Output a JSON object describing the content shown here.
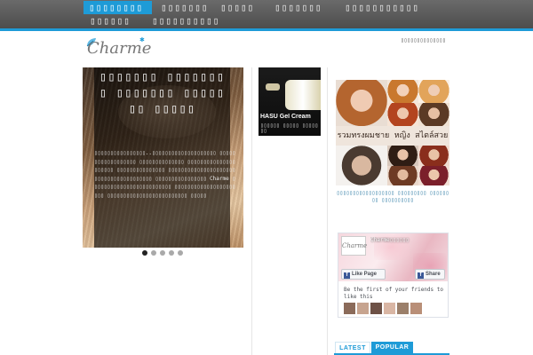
{
  "nav": {
    "row1": [
      "▯▯▯▯▯▯▯▯",
      "▯▯▯▯▯▯▯",
      "▯▯▯▯▯",
      "▯▯▯▯▯▯▯",
      "▯▯▯▯▯▯▯▯▯▯▯"
    ],
    "row2": [
      "▯▯▯▯▯▯",
      "▯▯▯▯▯▯▯▯▯▯"
    ],
    "active_index": 0
  },
  "header": {
    "logo_text": "Charme",
    "right_text": "▯▯▯▯▯▯▯▯▯▯▯▯▯▯"
  },
  "slider": {
    "title": "▯▯▯▯▯▯▯ ▯▯▯▯▯▯▯▯ ▯▯▯▯▯▯▯ ▯▯▯▯▯▯▯ ▯▯▯▯▯",
    "body": "▯▯▯▯▯▯▯▯▯▯▯▯▯▯▯▯..▯▯▯▯▯▯▯▯▯▯▯▯▯▯▯▯▯▯▯▯ ▯▯▯▯▯▯▯▯▯▯▯▯▯▯▯▯▯▯ ▯▯▯▯▯▯▯▯▯▯▯▯▯▯ ▯▯▯▯▯▯▯▯▯▯▯▯▯▯▯▯▯▯▯▯▯ ▯▯▯▯▯▯▯▯▯▯▯▯▯▯▯ ▯▯▯▯▯▯▯▯▯▯▯▯▯▯▯▯▯▯▯▯▯ ▯▯▯▯▯▯▯▯▯▯▯▯▯▯▯▯▯▯ ▯▯▯▯▯▯▯▯▯▯▯▯▯▯▯▯ Charme ▯▯▯▯▯▯▯▯▯▯▯▯▯▯▯▯▯▯▯▯▯▯▯▯▯ ▯▯▯▯▯▯▯▯▯▯▯▯▯▯▯▯▯▯▯▯▯▯ ▯▯▯▯▯▯▯▯▯▯▯▯▯▯▯▯▯▯▯▯▯▯▯▯▯ ▯▯▯▯▯",
    "dot_count": 5,
    "active_dot": 0
  },
  "post": {
    "title": "HASU Gel Cream",
    "subtitle": "▯▯▯▯▯▯ ▯▯▯▯▯ ▯▯▯▯▯▯▯"
  },
  "ad": {
    "banner_text": "รวมทรงผมชาย หญิง สไตล์สวย",
    "caption": "▯▯▯▯▯▯▯▯▯▯▯▯▯▯▯▯▯▯ ▯▯▯▯▯▯▯▯▯ ▯▯▯▯▯▯▯▯ ▯▯▯▯▯▯▯▯▯▯"
  },
  "facebook": {
    "avatar_text": "Charme",
    "page_name": "Charme▯▯▯▯▯▯",
    "like_label": "Like Page",
    "share_label": "Share",
    "friends_text": "Be the first of your friends to like this"
  },
  "tabs": {
    "items": [
      "LATEST",
      "POPULAR"
    ],
    "active_index": 1
  },
  "colors": {
    "accent": "#1e9bd7",
    "nav_bg": "#5a5a5a",
    "facebook": "#3b5998"
  }
}
